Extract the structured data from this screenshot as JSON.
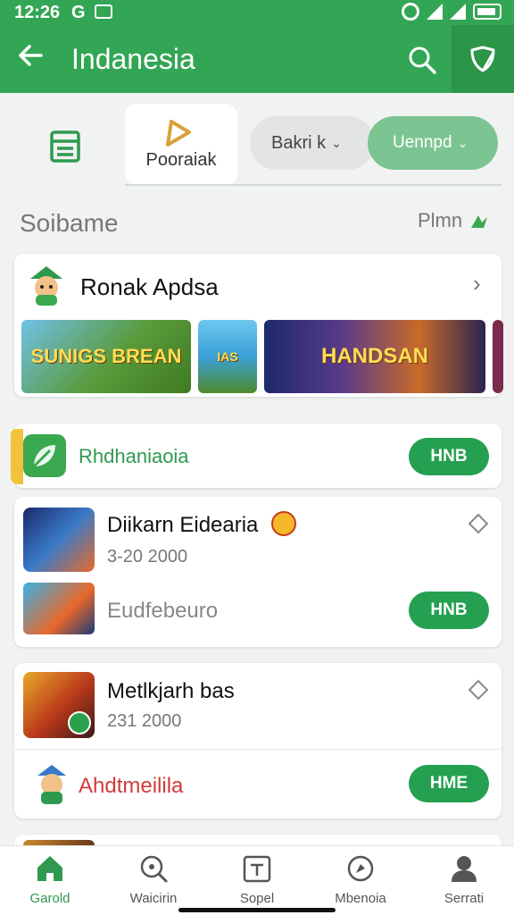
{
  "status": {
    "time": "12:26",
    "g": "G"
  },
  "appbar": {
    "title": "Indanesia",
    "back_icon": "arrow-left-icon",
    "search_icon": "search-icon",
    "shield_icon": "shield-icon"
  },
  "tabs": {
    "tab2_label": "Pooraiak"
  },
  "filters": {
    "pill1": "Bakri k",
    "pill2": "Uennpd"
  },
  "section": {
    "title": "Soibame",
    "right_label": "Plmn"
  },
  "featured": {
    "name": "Ronak Apdsa",
    "thumb1": "SUNIGS BREAN",
    "thumb2": "IAS",
    "thumb3": "HANDSAN"
  },
  "row_promo": {
    "label": "Rhdhaniaoia",
    "button": "HNB"
  },
  "item1": {
    "name": "Diikarn Eidearia",
    "sub": "3-20 2000",
    "sub2": "Eudfebeuro",
    "button": "HNB"
  },
  "item2": {
    "name": "Metlkjarh bas",
    "sub": "231 2000",
    "sub2": "Ahdtmeilila",
    "button": "HME"
  },
  "nav": {
    "items": [
      {
        "label": "Garold",
        "icon": "home-icon"
      },
      {
        "label": "Waicirin",
        "icon": "search-icon"
      },
      {
        "label": "Sopel",
        "icon": "calendar-icon"
      },
      {
        "label": "Mbenoia",
        "icon": "compass-icon"
      },
      {
        "label": "Serrati",
        "icon": "person-icon"
      }
    ]
  },
  "colors": {
    "primary": "#33a655",
    "button": "#25a051",
    "accent_text": "#2f9a4f",
    "red_text": "#d23a3a"
  }
}
